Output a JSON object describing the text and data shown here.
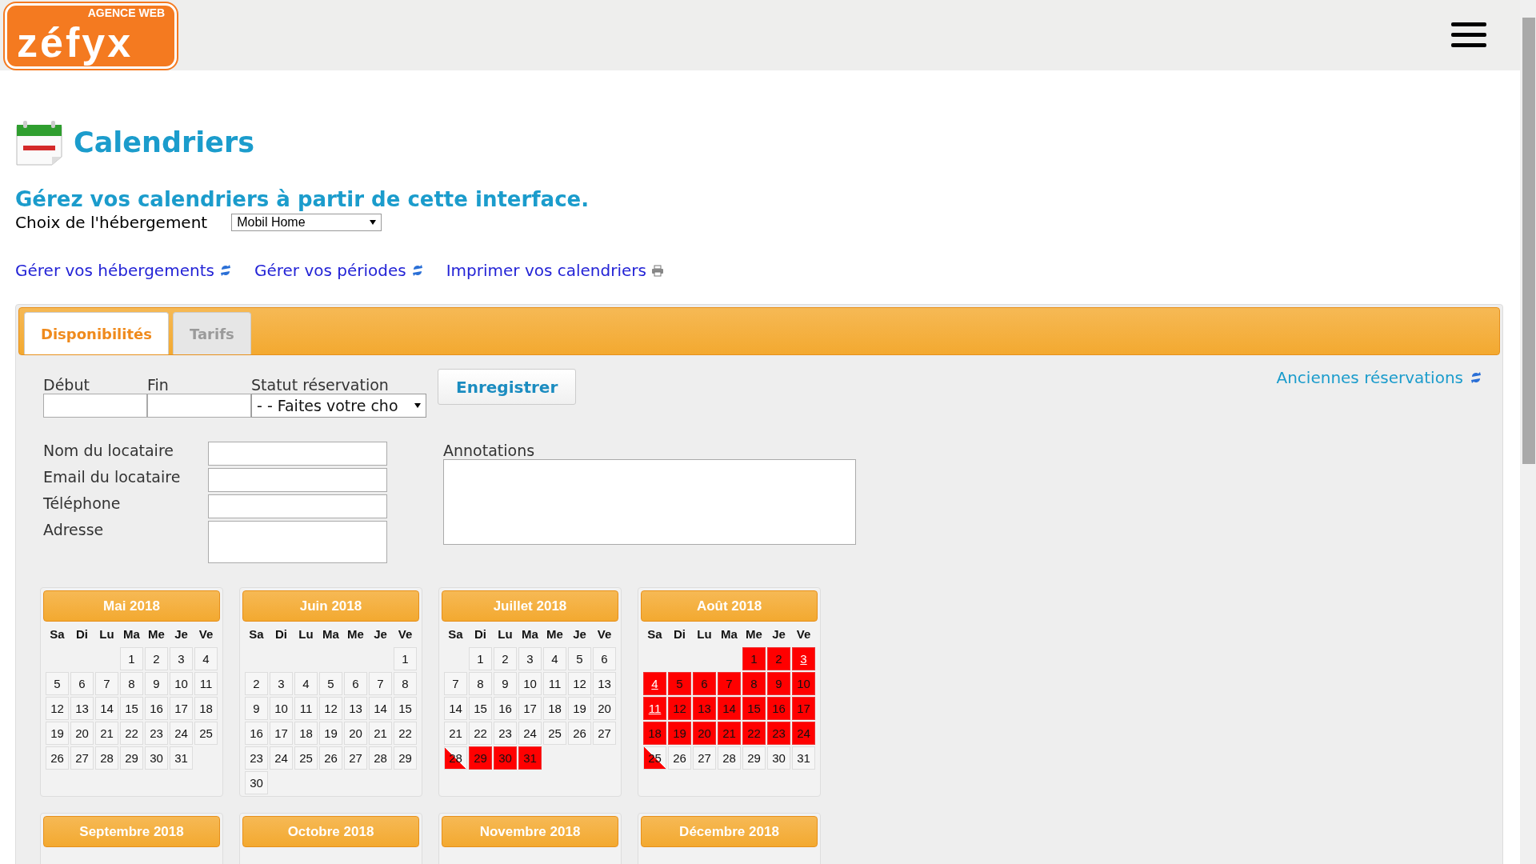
{
  "header": {
    "logo": {
      "wordmark": "zéfyx",
      "tagline": "AGENCE WEB"
    }
  },
  "page": {
    "title": "Calendriers",
    "subtitle": "Gérez vos calendriers à partir de cette interface.",
    "lodging_label": "Choix de l'hébergement",
    "lodging_value": "Mobil Home",
    "links": [
      {
        "label": "Gérer vos hébergements",
        "kind": "refresh"
      },
      {
        "label": "Gérer vos périodes",
        "kind": "refresh"
      },
      {
        "label": "Imprimer vos calendriers",
        "kind": "print"
      }
    ]
  },
  "tabs": [
    {
      "label": "Disponibilités",
      "selected": true
    },
    {
      "label": "Tarifs",
      "selected": false
    }
  ],
  "form": {
    "start_label": "Début",
    "end_label": "Fin",
    "status_label": "Statut réservation",
    "status_value": "- - Faites votre cho",
    "save_button": "Enregistrer",
    "old_bookings_link": "Anciennes réservations",
    "fields": [
      {
        "label": "Nom du locataire",
        "kind": "input"
      },
      {
        "label": "Email du locataire",
        "kind": "input"
      },
      {
        "label": "Téléphone",
        "kind": "input"
      },
      {
        "label": "Adresse",
        "kind": "textarea"
      }
    ],
    "annotations_label": "Annotations"
  },
  "months": [
    {
      "title": "Mai 2018",
      "weekdays": [
        "Sa",
        "Di",
        "Lu",
        "Ma",
        "Me",
        "Je",
        "Ve"
      ],
      "weeks": [
        [
          {
            "label": "1",
            "kind": "free"
          },
          {
            "label": "2",
            "kind": "free"
          },
          {
            "label": "3",
            "kind": "free"
          },
          {
            "label": "4",
            "kind": "free"
          }
        ],
        [
          {
            "label": "5",
            "kind": "free"
          },
          {
            "label": "6",
            "kind": "free"
          },
          {
            "label": "7",
            "kind": "free"
          },
          {
            "label": "8",
            "kind": "free"
          },
          {
            "label": "9",
            "kind": "free"
          },
          {
            "label": "10",
            "kind": "free"
          },
          {
            "label": "11",
            "kind": "free"
          }
        ],
        [
          {
            "label": "12",
            "kind": "free"
          },
          {
            "label": "13",
            "kind": "free"
          },
          {
            "label": "14",
            "kind": "free"
          },
          {
            "label": "15",
            "kind": "free"
          },
          {
            "label": "16",
            "kind": "free"
          },
          {
            "label": "17",
            "kind": "free"
          },
          {
            "label": "18",
            "kind": "free"
          }
        ],
        [
          {
            "label": "19",
            "kind": "free"
          },
          {
            "label": "20",
            "kind": "free"
          },
          {
            "label": "21",
            "kind": "free"
          },
          {
            "label": "22",
            "kind": "free"
          },
          {
            "label": "23",
            "kind": "free"
          },
          {
            "label": "24",
            "kind": "free"
          },
          {
            "label": "25",
            "kind": "free"
          }
        ],
        [
          {
            "label": "26",
            "kind": "free"
          },
          {
            "label": "27",
            "kind": "free"
          },
          {
            "label": "28",
            "kind": "free"
          },
          {
            "label": "29",
            "kind": "free"
          },
          {
            "label": "30",
            "kind": "free"
          },
          {
            "label": "31",
            "kind": "free"
          }
        ]
      ]
    },
    {
      "title": "Juin 2018",
      "weekdays": [
        "Sa",
        "Di",
        "Lu",
        "Ma",
        "Me",
        "Je",
        "Ve"
      ],
      "weeks": [
        [
          {
            "label": "1",
            "kind": "free"
          }
        ],
        [
          {
            "label": "2",
            "kind": "free"
          },
          {
            "label": "3",
            "kind": "free"
          },
          {
            "label": "4",
            "kind": "free"
          },
          {
            "label": "5",
            "kind": "free"
          },
          {
            "label": "6",
            "kind": "free"
          },
          {
            "label": "7",
            "kind": "free"
          },
          {
            "label": "8",
            "kind": "free"
          }
        ],
        [
          {
            "label": "9",
            "kind": "free"
          },
          {
            "label": "10",
            "kind": "free"
          },
          {
            "label": "11",
            "kind": "free"
          },
          {
            "label": "12",
            "kind": "free"
          },
          {
            "label": "13",
            "kind": "free"
          },
          {
            "label": "14",
            "kind": "free"
          },
          {
            "label": "15",
            "kind": "free"
          }
        ],
        [
          {
            "label": "16",
            "kind": "free"
          },
          {
            "label": "17",
            "kind": "free"
          },
          {
            "label": "18",
            "kind": "free"
          },
          {
            "label": "19",
            "kind": "free"
          },
          {
            "label": "20",
            "kind": "free"
          },
          {
            "label": "21",
            "kind": "free"
          },
          {
            "label": "22",
            "kind": "free"
          }
        ],
        [
          {
            "label": "23",
            "kind": "free"
          },
          {
            "label": "24",
            "kind": "free"
          },
          {
            "label": "25",
            "kind": "free"
          },
          {
            "label": "26",
            "kind": "free"
          },
          {
            "label": "27",
            "kind": "free"
          },
          {
            "label": "28",
            "kind": "free"
          },
          {
            "label": "29",
            "kind": "free"
          }
        ],
        [
          {
            "label": "30",
            "kind": "free"
          }
        ]
      ]
    },
    {
      "title": "Juillet 2018",
      "weekdays": [
        "Sa",
        "Di",
        "Lu",
        "Ma",
        "Me",
        "Je",
        "Ve"
      ],
      "weeks": [
        [
          {
            "label": "1",
            "kind": "free"
          },
          {
            "label": "2",
            "kind": "free"
          },
          {
            "label": "3",
            "kind": "free"
          },
          {
            "label": "4",
            "kind": "free"
          },
          {
            "label": "5",
            "kind": "free"
          },
          {
            "label": "6",
            "kind": "free"
          }
        ],
        [
          {
            "label": "7",
            "kind": "free"
          },
          {
            "label": "8",
            "kind": "free"
          },
          {
            "label": "9",
            "kind": "free"
          },
          {
            "label": "10",
            "kind": "free"
          },
          {
            "label": "11",
            "kind": "free"
          },
          {
            "label": "12",
            "kind": "free"
          },
          {
            "label": "13",
            "kind": "free"
          }
        ],
        [
          {
            "label": "14",
            "kind": "free"
          },
          {
            "label": "15",
            "kind": "free"
          },
          {
            "label": "16",
            "kind": "free"
          },
          {
            "label": "17",
            "kind": "free"
          },
          {
            "label": "18",
            "kind": "free"
          },
          {
            "label": "19",
            "kind": "free"
          },
          {
            "label": "20",
            "kind": "free"
          }
        ],
        [
          {
            "label": "21",
            "kind": "free"
          },
          {
            "label": "22",
            "kind": "free"
          },
          {
            "label": "23",
            "kind": "free"
          },
          {
            "label": "24",
            "kind": "free"
          },
          {
            "label": "25",
            "kind": "free"
          },
          {
            "label": "26",
            "kind": "free"
          },
          {
            "label": "27",
            "kind": "free"
          }
        ],
        [
          {
            "label": "28",
            "kind": "arrival"
          },
          {
            "label": "29",
            "kind": "booked"
          },
          {
            "label": "30",
            "kind": "booked"
          },
          {
            "label": "31",
            "kind": "booked"
          }
        ]
      ]
    },
    {
      "title": "Août 2018",
      "weekdays": [
        "Sa",
        "Di",
        "Lu",
        "Ma",
        "Me",
        "Je",
        "Ve"
      ],
      "weeks": [
        [
          {
            "label": "1",
            "kind": "booked"
          },
          {
            "label": "2",
            "kind": "booked"
          },
          {
            "label": "3",
            "kind": "linked"
          }
        ],
        [
          {
            "label": "4",
            "kind": "linked"
          },
          {
            "label": "5",
            "kind": "booked"
          },
          {
            "label": "6",
            "kind": "booked"
          },
          {
            "label": "7",
            "kind": "booked"
          },
          {
            "label": "8",
            "kind": "booked"
          },
          {
            "label": "9",
            "kind": "booked"
          },
          {
            "label": "10",
            "kind": "booked"
          }
        ],
        [
          {
            "label": "11",
            "kind": "linked"
          },
          {
            "label": "12",
            "kind": "booked"
          },
          {
            "label": "13",
            "kind": "booked"
          },
          {
            "label": "14",
            "kind": "booked"
          },
          {
            "label": "15",
            "kind": "booked"
          },
          {
            "label": "16",
            "kind": "booked"
          },
          {
            "label": "17",
            "kind": "booked"
          }
        ],
        [
          {
            "label": "18",
            "kind": "booked"
          },
          {
            "label": "19",
            "kind": "booked"
          },
          {
            "label": "20",
            "kind": "booked"
          },
          {
            "label": "21",
            "kind": "booked"
          },
          {
            "label": "22",
            "kind": "booked"
          },
          {
            "label": "23",
            "kind": "booked"
          },
          {
            "label": "24",
            "kind": "booked"
          }
        ],
        [
          {
            "label": "25",
            "kind": "arrival"
          },
          {
            "label": "26",
            "kind": "free"
          },
          {
            "label": "27",
            "kind": "free"
          },
          {
            "label": "28",
            "kind": "free"
          },
          {
            "label": "29",
            "kind": "free"
          },
          {
            "label": "30",
            "kind": "free"
          },
          {
            "label": "31",
            "kind": "free"
          }
        ]
      ]
    },
    {
      "title": "Septembre 2018"
    },
    {
      "title": "Octobre 2018"
    },
    {
      "title": "Novembre 2018"
    },
    {
      "title": "Décembre 2018"
    }
  ]
}
